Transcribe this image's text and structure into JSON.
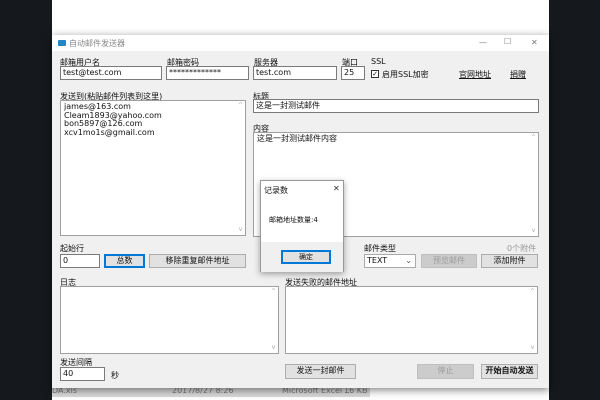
{
  "window": {
    "title": "自动邮件发送器",
    "minimize": "—",
    "maximize": "☐",
    "close": "✕"
  },
  "form": {
    "username_label": "邮箱用户名",
    "username": "test@test.com",
    "password_label": "邮箱密码",
    "password": "*************",
    "server_label": "服务器",
    "server": "test.com",
    "port_label": "端口",
    "port": "25",
    "ssl_label": "SSL",
    "ssl_checkbox_label": "启用SSL加密",
    "ssl_checked": true,
    "website_link": "官网地址",
    "donate_link": "捐赠",
    "recipients_label": "发送到(粘贴邮件列表到这里)",
    "recipients": [
      "james@163.com",
      "Cleam1893@yahoo.com",
      "bon5897@126.com",
      "xcv1mo1s@gmail.com"
    ],
    "subject_label": "标题",
    "subject": "这是一封测试邮件",
    "content_label": "内容",
    "content": "这是一封测试邮件内容",
    "start_row_label": "起始行",
    "start_row": "0",
    "total_button": "总数",
    "dedupe_button": "移除重复邮件地址",
    "mail_type_label": "邮件类型",
    "mail_type": "TEXT",
    "preview_button": "预览邮件",
    "attachments_count": "0个附件",
    "add_attachment_button": "添加附件",
    "log_label": "日志",
    "failed_label": "发送失败的邮件地址",
    "interval_label": "发送间隔",
    "interval": "40",
    "interval_unit": "秒",
    "send_one_button": "发送一封邮件",
    "stop_button": "停止",
    "start_button": "开始自动发送"
  },
  "dialog": {
    "title": "记录数",
    "message": "邮箱地址数量:4",
    "ok_button": "确定",
    "close": "✕"
  },
  "background_file": {
    "name": "DA.xls",
    "date": "2017/8/27 8:26",
    "type": "Microsoft Excel ...",
    "size": "16 KB"
  }
}
